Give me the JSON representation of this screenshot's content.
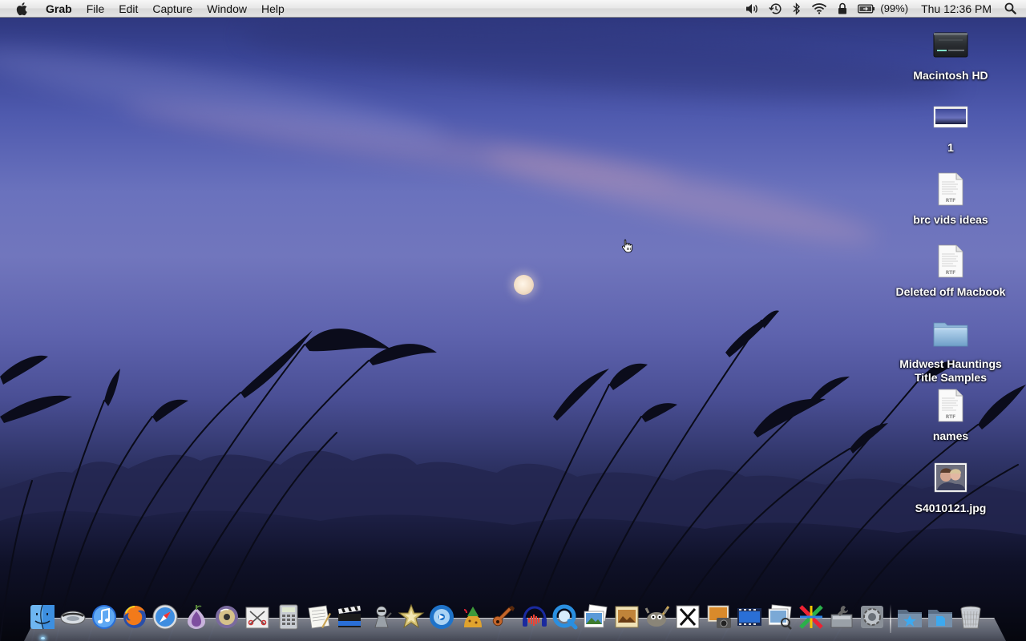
{
  "menubar": {
    "apple_icon": "apple-logo-icon",
    "app_name": "Grab",
    "menus": [
      "File",
      "Edit",
      "Capture",
      "Window",
      "Help"
    ],
    "status": {
      "volume_icon": "speaker-icon",
      "time_machine_icon": "time-machine-icon",
      "bluetooth_icon": "bluetooth-icon",
      "wifi_icon": "wifi-icon",
      "lock_icon": "lock-icon",
      "battery_icon": "battery-charging-icon",
      "battery_percent": "(99%)",
      "clock": "Thu 12:36 PM",
      "spotlight_icon": "spotlight-search-icon"
    }
  },
  "desktop_icons": [
    {
      "label": "Macintosh HD",
      "icon": "hard-drive-icon"
    },
    {
      "label": "1",
      "icon": "image-thumbnail-icon"
    },
    {
      "label": "brc vids ideas",
      "icon": "rtf-document-icon",
      "badge": "RTF"
    },
    {
      "label": "Deleted off Macbook",
      "icon": "rtf-document-icon",
      "badge": "RTF"
    },
    {
      "label": "Midwest Hauntings\nTitle Samples",
      "icon": "folder-icon"
    },
    {
      "label": "names",
      "icon": "rtf-document-icon",
      "badge": "RTF"
    },
    {
      "label": "S4010121.jpg",
      "icon": "photo-thumbnail-icon"
    }
  ],
  "dock": {
    "apps": [
      {
        "icon": "finder-icon",
        "running": true
      },
      {
        "icon": "mail-icon",
        "running": false
      },
      {
        "icon": "itunes-icon",
        "running": false
      },
      {
        "icon": "firefox-icon",
        "running": false
      },
      {
        "icon": "safari-icon",
        "running": false
      },
      {
        "icon": "tor-onion-icon",
        "running": false
      },
      {
        "icon": "disc-app-icon",
        "running": false
      },
      {
        "icon": "scissors-app-icon",
        "running": false
      },
      {
        "icon": "calculator-icon",
        "running": false
      },
      {
        "icon": "textedit-icon",
        "running": false
      },
      {
        "icon": "imovie-clapper-icon",
        "running": false
      },
      {
        "icon": "automator-icon",
        "running": false
      },
      {
        "icon": "imovie-star-icon",
        "running": false
      },
      {
        "icon": "dvd-player-icon",
        "running": false
      },
      {
        "icon": "adium-icon",
        "running": false
      },
      {
        "icon": "garageband-guitar-icon",
        "running": false
      },
      {
        "icon": "audacity-icon",
        "running": false
      },
      {
        "icon": "quicktime-icon",
        "running": false
      },
      {
        "icon": "iphoto-icon",
        "running": false
      },
      {
        "icon": "slideshow-icon",
        "running": false
      },
      {
        "icon": "gimp-icon",
        "running": false
      },
      {
        "icon": "x11-icon",
        "running": false
      },
      {
        "icon": "image-capture-icon",
        "running": false
      },
      {
        "icon": "video-app-icon",
        "running": false
      },
      {
        "icon": "preview-icon",
        "running": false
      },
      {
        "icon": "colorful-arrows-icon",
        "running": false
      },
      {
        "icon": "disk-utility-icon",
        "running": false
      },
      {
        "icon": "system-preferences-icon",
        "running": false
      }
    ],
    "folders": [
      {
        "icon": "applications-folder-icon"
      },
      {
        "icon": "documents-folder-icon"
      }
    ],
    "trash": {
      "icon": "trash-icon"
    }
  },
  "colors": {
    "menubar_bg": "#e6e6e6",
    "sky_top": "#2a3275",
    "sky_mid": "#7176bd",
    "ground": "#070812",
    "moon": "#f2dec6"
  }
}
